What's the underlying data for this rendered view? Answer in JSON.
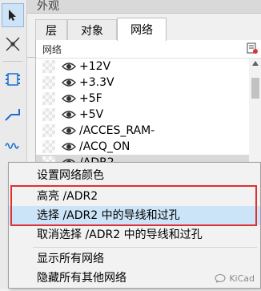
{
  "panel": {
    "title": "外观"
  },
  "tabs": [
    {
      "label": "层"
    },
    {
      "label": "对象"
    },
    {
      "label": "网络",
      "selected": true
    }
  ],
  "net_list": {
    "header": "网络",
    "items": [
      {
        "name": "+12V"
      },
      {
        "name": "+3.3V"
      },
      {
        "name": "+5F"
      },
      {
        "name": "+5V"
      },
      {
        "name": "/ACCES_RAM-"
      },
      {
        "name": "/ACQ_ON"
      },
      {
        "name": "/ADR2",
        "selected": true
      }
    ]
  },
  "context_menu": {
    "items": [
      {
        "label": "设置网络颜色"
      },
      {
        "label": "高亮 /ADR2"
      },
      {
        "label": "选择 /ADR2 中的导线和过孔"
      },
      {
        "label": "取消选择 /ADR2 中的导线和过孔"
      },
      {
        "label": "显示所有网络"
      },
      {
        "label": "隐藏所有其他网络"
      }
    ],
    "highlight_color": "#e03030",
    "hover_color": "#cce4f7"
  },
  "left_toolbar": {
    "tools": [
      "cursor-icon",
      "cross-icon",
      "footprint-icon",
      "route-track-icon",
      "diff-pair-icon"
    ]
  },
  "watermark": {
    "text": "KiCad"
  }
}
